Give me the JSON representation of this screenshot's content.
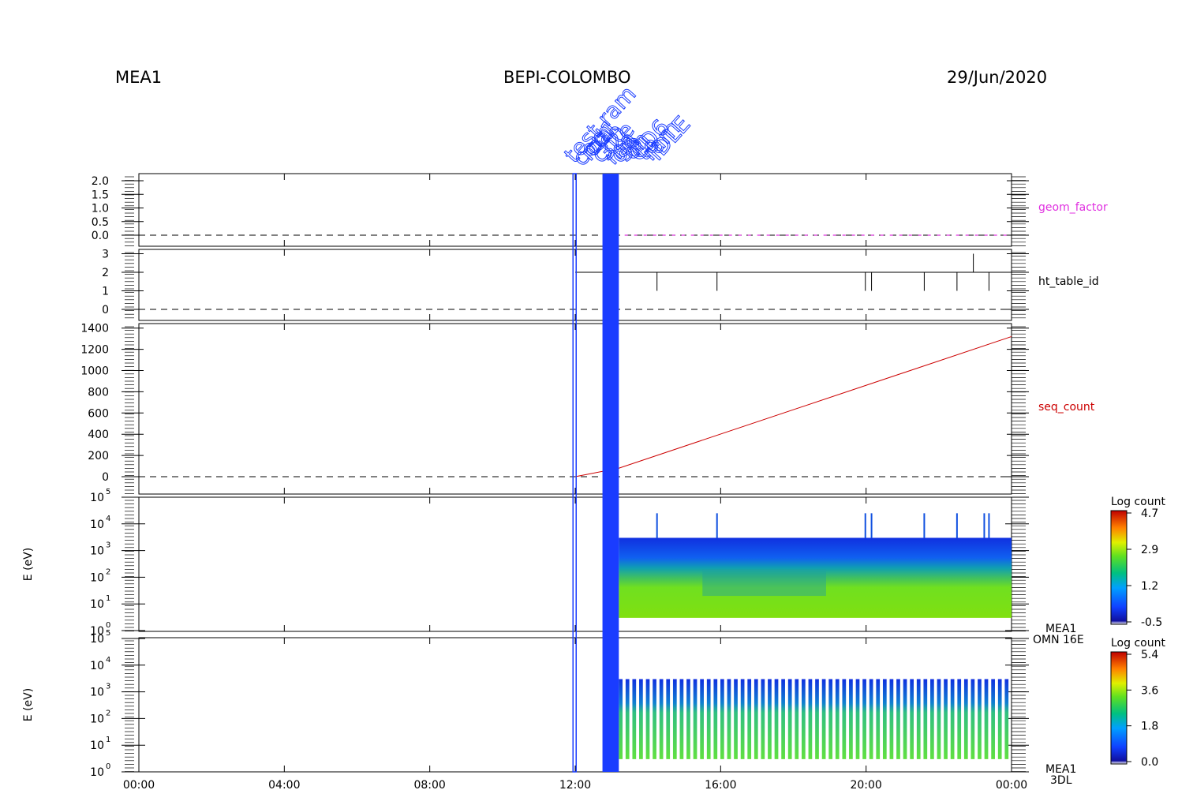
{
  "header": {
    "left": "MEA1",
    "center": "BEPI-COLOMBO",
    "right": "29/Jun/2020"
  },
  "annotations": [
    "test ram",
    "com",
    "ma",
    "cd1",
    "ch0",
    "32e",
    "ma",
    "on",
    "sp",
    "on",
    "CD6",
    "to",
    "ram",
    "IDLE"
  ],
  "colors": {
    "geom_factor": "#e030e0",
    "ht_table_id": "#000000",
    "seq_count": "#cc0000",
    "annotation": "#1a3cff",
    "event_bar": "#1a3cff"
  },
  "chart_data": [
    {
      "type": "line",
      "label": "geom_factor",
      "ylim": [
        -0.3,
        2.2
      ],
      "yticks": [
        "2.0",
        "1.5",
        "1.0",
        "0.5",
        "0.0"
      ],
      "ytick_values": [
        2.0,
        1.5,
        1.0,
        0.5,
        0.0
      ],
      "x": [
        13.1,
        24.0
      ],
      "y": [
        0.0,
        0.0
      ]
    },
    {
      "type": "line",
      "label": "ht_table_id",
      "ylim": [
        -0.5,
        3.3
      ],
      "yticks": [
        "3",
        "2",
        "1",
        "0"
      ],
      "ytick_values": [
        3,
        2,
        1,
        0
      ],
      "baseline": 2,
      "x_range": [
        12.0,
        24.0
      ],
      "dips": [
        [
          14.25,
          1
        ],
        [
          15.9,
          1
        ],
        [
          19.98,
          1
        ],
        [
          20.15,
          1
        ],
        [
          21.6,
          1
        ],
        [
          22.5,
          1
        ],
        [
          23.38,
          1
        ]
      ],
      "spikes": [
        [
          22.95,
          3
        ]
      ]
    },
    {
      "type": "line",
      "label": "seq_count",
      "ylim": [
        -130,
        1400
      ],
      "yticks": [
        "1400",
        "1200",
        "1000",
        "800",
        "600",
        "400",
        "200",
        "0"
      ],
      "ytick_values": [
        1400,
        1200,
        1000,
        800,
        600,
        400,
        200,
        0
      ],
      "x": [
        12.0,
        13.2,
        24.0
      ],
      "y": [
        0,
        80,
        1320
      ]
    },
    {
      "type": "heatmap",
      "label": "MEA1",
      "sublabel": "OMN 16E",
      "ylabel": "E (eV)",
      "yscale": "log",
      "yticks": [
        "10",
        "10",
        "10",
        "10",
        "10",
        "10"
      ],
      "ytick_exponents": [
        "0",
        "1",
        "2",
        "3",
        "4",
        "5"
      ],
      "colorbar": {
        "title": "Log count",
        "ticks": [
          "4.7",
          "2.9",
          "1.2",
          "-0.5"
        ],
        "range": [
          -0.5,
          4.7
        ]
      },
      "x_range": [
        13.2,
        24.0
      ],
      "energy_range": [
        3,
        3000
      ],
      "spikes_at": [
        14.25,
        15.9,
        19.98,
        20.15,
        21.6,
        22.5,
        23.25,
        23.38
      ]
    },
    {
      "type": "heatmap",
      "label": "MEA1",
      "sublabel": "3DL",
      "ylabel": "E (eV)",
      "yscale": "log",
      "yticks": [
        "10",
        "10",
        "10",
        "10",
        "10",
        "10"
      ],
      "ytick_exponents": [
        "0",
        "1",
        "2",
        "3",
        "4",
        "5"
      ],
      "colorbar": {
        "title": "Log count",
        "ticks": [
          "5.4",
          "3.6",
          "1.8",
          "0.0"
        ],
        "range": [
          0.0,
          5.4
        ]
      },
      "x_range": [
        13.2,
        24.0
      ],
      "energy_range": [
        3,
        3000
      ],
      "stripes": 58
    }
  ],
  "xaxis": {
    "ticks": [
      "00:00",
      "04:00",
      "08:00",
      "12:00",
      "16:00",
      "20:00",
      "00:00"
    ],
    "range_hours": [
      0,
      24
    ]
  }
}
